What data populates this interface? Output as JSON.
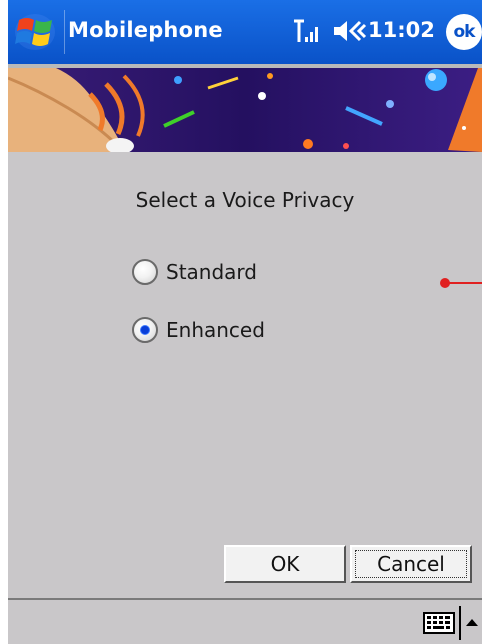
{
  "titlebar": {
    "app_title": "Mobilephone",
    "time": "11:02",
    "ok_label": "ok",
    "start_icon": "windows-flag-icon",
    "signal_icon": "signal-strength-icon",
    "volume_icon": "speaker-volume-icon"
  },
  "dialog": {
    "prompt": "Select a Voice Privacy",
    "options": [
      {
        "label": "Standard",
        "selected": false
      },
      {
        "label": "Enhanced",
        "selected": true
      }
    ],
    "ok_label": "OK",
    "cancel_label": "Cancel"
  },
  "bottombar": {
    "keyboard_icon": "keyboard-icon",
    "arrow_icon": "up-arrow-icon"
  },
  "colors": {
    "titlebar": "#0a52c8",
    "background": "#c9c7c9",
    "banner": "#1d0f52",
    "radio_dot": "#0b3fd8",
    "marker": "#e02020"
  }
}
